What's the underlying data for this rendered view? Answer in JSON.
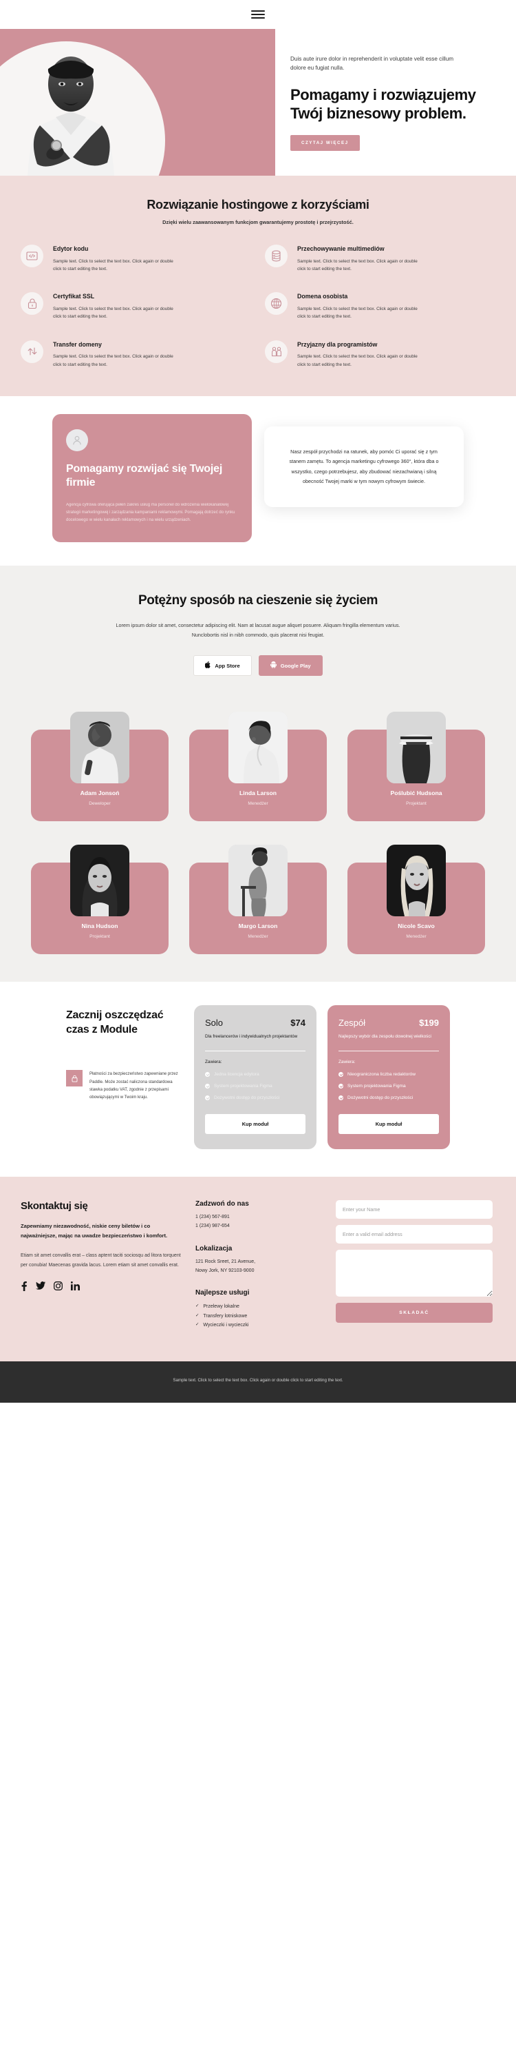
{
  "header": {
    "menu_icon": "hamburger-menu-icon"
  },
  "hero": {
    "subtitle": "Duis aute irure dolor in reprehenderit in voluptate velit esse cillum dolore eu fugiat nulla.",
    "title": "Pomagamy i rozwiązujemy Twój biznesowy problem.",
    "cta": "Czytaj więcej"
  },
  "features": {
    "title": "Rozwiązanie hostingowe z korzyściami",
    "subtitle": "Dzięki wielu zaawansowanym funkcjom gwarantujemy prostotę i przejrzystość.",
    "body": "Sample text. Click to select the text box. Click again or double click to start editing the text.",
    "items": [
      {
        "icon": "code-icon",
        "title": "Edytor kodu"
      },
      {
        "icon": "database-icon",
        "title": "Przechowywanie multimediów"
      },
      {
        "icon": "lock-icon",
        "title": "Certyfikat SSL"
      },
      {
        "icon": "globe-icon",
        "title": "Domena osobista"
      },
      {
        "icon": "transfer-arrows-icon",
        "title": "Transfer domeny"
      },
      {
        "icon": "people-icon",
        "title": "Przyjazny dla programistów"
      }
    ]
  },
  "grow": {
    "icon": "user-avatar-icon",
    "title": "Pomagamy rozwijać się Twojej firmie",
    "paragraph": "Agencja cyfrowa oferująca pełen zakres usług ma personel do wdrożenia wielokanałowej strategii marketingowej i zarządzania kampaniami reklamowymi. Pomagają dotrzeć do rynku docelowego w wielu kanałach reklamowych i na wielu urządzeniach.",
    "quote": "Nasz zespół przychodzi na ratunek, aby pomóc Ci uporać się z tym stanem zamętu. To agencja marketingu cyfrowego 360°, która dba o wszystko, czego potrzebujesz, aby zbudować niezachwianą i silną obecność Twojej marki w tym nowym cyfrowym świecie."
  },
  "app": {
    "title": "Potężny sposób na cieszenie się życiem",
    "paragraph": "Lorem ipsum dolor sit amet, consectetur adipiscing elit. Nam at lacusat augue aliquet posuere. Aliquam fringilla elementum varius. Nunclobortis nisl in nibh commodo, quis placerat nisi feugiat.",
    "buttons": [
      {
        "icon": "apple-icon",
        "label": "App Store"
      },
      {
        "icon": "android-icon",
        "label": "Google Play"
      }
    ]
  },
  "team": {
    "members": [
      {
        "name": "Adam Jonsoń",
        "role": "Deweloper"
      },
      {
        "name": "Linda Larson",
        "role": "Menedżer"
      },
      {
        "name": "Poślubić Hudsona",
        "role": "Projektant"
      },
      {
        "name": "Nina Hudson",
        "role": "Projektant"
      },
      {
        "name": "Margo Larson",
        "role": "Menedżer"
      },
      {
        "name": "Nicole Scavo",
        "role": "Menedżer"
      }
    ]
  },
  "pricing": {
    "title": "Zacznij oszczędzać czas z Module",
    "note_icon": "lock-icon",
    "note": "Płatności za bezpieczeństwo zapewniane przez Paddle. Może zostać naliczona standardowa stawka podatku VAT, zgodnie z przepisami obowiązującymi w Twoim kraju.",
    "includes_label": "Zawiera:",
    "plans": [
      {
        "name": "Solo",
        "price": "$74",
        "desc": "Dla freelancerów i indywidualnych projektantów",
        "features": [
          "Jedna licencja edytora",
          "System projektowania Figma",
          "Dożywotni dostęp do przyszłości"
        ],
        "cta": "Kup moduł"
      },
      {
        "name": "Zespół",
        "price": "$199",
        "desc": "Najlepszy wybór dla zespołu dowolnej wielkości",
        "features": [
          "Nieograniczona liczba redaktorów",
          "System projektowania Figma",
          "Dożywotni dostęp do przyszłości"
        ],
        "cta": "Kup moduł"
      }
    ]
  },
  "contact": {
    "title": "Skontaktuj się",
    "lead": "Zapewniamy niezawodność, niskie ceny biletów i co najważniejsze, mając na uwadze bezpieczeństwo i komfort.",
    "body": "Etiam sit amet convallis erat – class aptent taciti sociosqu ad litora torquent per conubia! Maecenas gravida lacus. Lorem etiam sit amet convallis erat.",
    "socials": [
      "facebook-icon",
      "twitter-icon",
      "instagram-icon",
      "linkedin-icon"
    ],
    "call_title": "Zadzwoń do nas",
    "phones": [
      "1 (234) 567-891",
      "1 (234) 987-654"
    ],
    "location_title": "Lokalizacja",
    "address": [
      "121 Rock Sreet, 21 Avenue,",
      "Nowy Jork, NY 92103-9000"
    ],
    "services_title": "Najlepsze usługi",
    "services": [
      "Przelewy lokalne",
      "Transfery lotniskowe",
      "Wycieczki i wycieczki"
    ],
    "form": {
      "name_placeholder": "Enter your Name",
      "email_placeholder": "Enter a valid email address",
      "message_value": "",
      "submit": "Składać"
    }
  },
  "footer": {
    "text": "Sample text. Click to select the text box. Click again or double click to start editing the text."
  },
  "colors": {
    "accent": "#cf9199",
    "features_bg": "#f0dcda",
    "light_bg": "#f1f0ee",
    "footer_bg": "#2e2e2e"
  }
}
